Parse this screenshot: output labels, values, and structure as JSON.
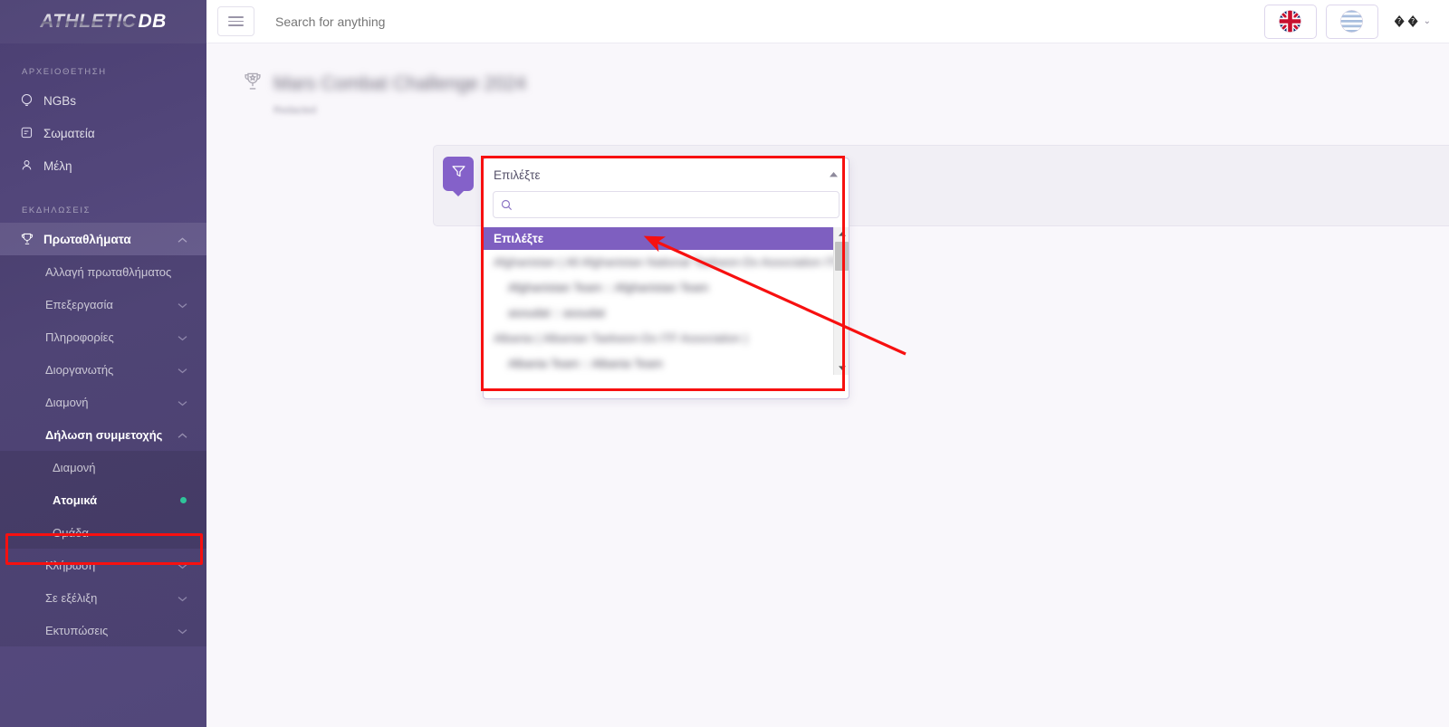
{
  "brand": {
    "part1": "ATHLETIC",
    "part2": "DB"
  },
  "sidebar": {
    "sections": [
      {
        "label": "ΑΡΧΕΙΟΘΕΤΗΣΗ",
        "items": [
          {
            "label": "NGBs",
            "icon": "globe-icon",
            "expandable": false
          },
          {
            "label": "Σωματεία",
            "icon": "boxing-glove-icon",
            "expandable": false
          },
          {
            "label": "Μέλη",
            "icon": "person-icon",
            "expandable": false
          }
        ]
      },
      {
        "label": "ΕΚΔΗΛΩΣΕΙΣ",
        "items": [
          {
            "label": "Πρωταθλήματα",
            "icon": "trophy-icon",
            "expandable": true,
            "expanded": true
          }
        ]
      }
    ],
    "submenu": [
      {
        "label": "Αλλαγή πρωταθλήματος",
        "expandable": false
      },
      {
        "label": "Επεξεργασία",
        "expandable": true
      },
      {
        "label": "Πληροφορίες",
        "expandable": true
      },
      {
        "label": "Διοργανωτής",
        "expandable": true
      },
      {
        "label": "Διαμονή",
        "expandable": true
      },
      {
        "label": "Δήλωση συμμετοχής",
        "expandable": true,
        "expanded": true
      }
    ],
    "submenu_participation": [
      {
        "label": "Διαμονή",
        "selected": false,
        "dot": false
      },
      {
        "label": "Ατομικά",
        "selected": true,
        "dot": true
      },
      {
        "label": "Ομάδα",
        "selected": false,
        "dot": false
      }
    ],
    "submenu_after": [
      {
        "label": "Κλήρωση",
        "expandable": true
      },
      {
        "label": "Σε εξέλιξη",
        "expandable": true
      },
      {
        "label": "Εκτυπώσεις",
        "expandable": true
      }
    ]
  },
  "topbar": {
    "menu_toggle": "hamburger-icon",
    "search_placeholder": "Search for anything",
    "search_value": "",
    "lang_en": "uk-flag-icon",
    "lang_el": "greece-flag-icon",
    "user_label": "◆◆",
    "user_chevron": "⌄"
  },
  "page": {
    "title": "Mars Combat Challenge 2024",
    "subtitle": "Redacted",
    "title_icon": "trophy-icon"
  },
  "filter": {
    "icon": "filter-icon"
  },
  "dropdown": {
    "selected_value": "Επιλέξτε",
    "caret": "▲",
    "search_placeholder": "",
    "search_value": "",
    "search_icon": "magnifier-icon",
    "highlighted_option": "Επιλέξτε",
    "options": [
      {
        "text": "Afghanistan ( All Afghanistan National Taekwon-Do Association ITF )",
        "type": "group"
      },
      {
        "text": "Afghanistan Team :: Afghanistan Team",
        "type": "child"
      },
      {
        "text": "asoudat :: asoudat",
        "type": "child"
      },
      {
        "text": "Albania ( Albanian Taekwon-Do ITF Association )",
        "type": "group"
      },
      {
        "text": "Albania Team :: Albania Team",
        "type": "child"
      }
    ],
    "scroll_up": "▲",
    "scroll_down": "▼"
  },
  "colors": {
    "sidebar_top": "#4b3f72",
    "sidebar_bottom": "#52477a",
    "accent_purple": "#7e5fc0",
    "filter_badge": "#8461c9",
    "annotation_red": "#f71010",
    "status_dot": "#2fc49a",
    "page_bg": "#f9f7fb",
    "card_bg": "#f1eff5"
  }
}
